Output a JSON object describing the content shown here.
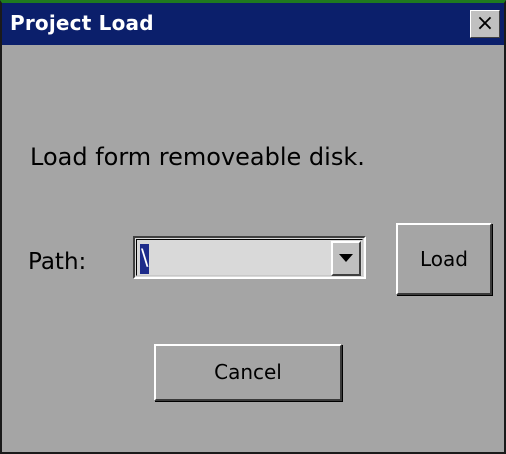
{
  "window": {
    "title": "Project Load",
    "close_glyph": "×",
    "colors": {
      "titlebar": "#0b1f6b",
      "body": "#a5a5a5",
      "selection": "#1d2b8a"
    }
  },
  "dialog": {
    "message": "Load form removeable disk.",
    "path_label": "Path:",
    "path_value": "\\",
    "dropdown_icon": "triangle-down-icon",
    "load_label": "Load",
    "cancel_label": "Cancel"
  }
}
